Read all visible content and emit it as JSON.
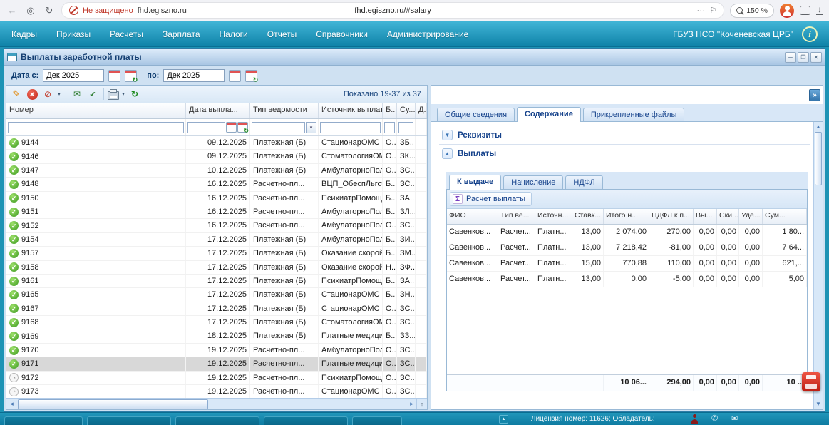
{
  "icons": {
    "back": "←",
    "site": "◎",
    "reload": "↻",
    "more": "⋯",
    "bookmark": "⚐",
    "download": "↓",
    "info": "i",
    "minimize": "─",
    "restore": "❐",
    "close": "✕",
    "edit": "✎",
    "delete": "✖",
    "sign": "⊘",
    "mail": "✉",
    "confirm": "✔",
    "dropdown": "▾",
    "refresh": "↻",
    "collapse": "»",
    "expand": "▼",
    "collapse_section": "▲",
    "sigma": "Σ",
    "scroll_left": "◂",
    "scroll_right": "▸",
    "scroll_up": "▲",
    "scroll_down": "▼",
    "resize": "↕",
    "taskbar_up": "▲",
    "phone": "✆",
    "envelope": "✉"
  },
  "browser": {
    "security_text": "Не защищено",
    "domain": "fhd.egiszno.ru",
    "url": "fhd.egiszno.ru/#salary",
    "zoom": "150 %"
  },
  "menubar": {
    "items": [
      "Кадры",
      "Приказы",
      "Расчеты",
      "Зарплата",
      "Налоги",
      "Отчеты",
      "Справочники",
      "Администрирование"
    ],
    "org": "ГБУЗ НСО \"Коченевская ЦРБ\""
  },
  "window_title": "Выплаты заработной платы",
  "filters": {
    "date_from_label": "Дата с:",
    "date_from_value": "Дек 2025",
    "date_to_label": "по:",
    "date_to_value": "Дек 2025"
  },
  "left_grid": {
    "shown_text": "Показано 19-37 из 37",
    "columns": [
      "Номер",
      "Дата выпла...",
      "Тип ведомости",
      "Источник выплат",
      "Б...",
      "Су...",
      "Д..."
    ],
    "rows": [
      {
        "num": "9144",
        "date": "09.12.2025",
        "type": "Платежная (Б)",
        "source": "СтационарОМС",
        "c5": "О...",
        "c6": "ЗБ...",
        "icon": "check"
      },
      {
        "num": "9146",
        "date": "09.12.2025",
        "type": "Платежная (Б)",
        "source": "СтоматологияОМС",
        "c5": "О...",
        "c6": "ЗК...",
        "icon": "check"
      },
      {
        "num": "9147",
        "date": "10.12.2025",
        "type": "Платежная (Б)",
        "source": "АмбулаторноПолик...",
        "c5": "О...",
        "c6": "ЗС...",
        "icon": "check"
      },
      {
        "num": "9148",
        "date": "16.12.2025",
        "type": "Расчетно-пл...",
        "source": "ВЦП_ОбеспЛьготно...",
        "c5": "Б...",
        "c6": "ЗС...",
        "icon": "check"
      },
      {
        "num": "9150",
        "date": "16.12.2025",
        "type": "Расчетно-пл...",
        "source": "ПсихиатрПомощь",
        "c5": "Б...",
        "c6": "ЗА...",
        "icon": "check"
      },
      {
        "num": "9151",
        "date": "16.12.2025",
        "type": "Расчетно-пл...",
        "source": "АмбулаторноПолик...",
        "c5": "Б...",
        "c6": "ЗЛ...",
        "icon": "check"
      },
      {
        "num": "9152",
        "date": "16.12.2025",
        "type": "Расчетно-пл...",
        "source": "АмбулаторноПолик...",
        "c5": "О...",
        "c6": "ЗС...",
        "icon": "check"
      },
      {
        "num": "9154",
        "date": "17.12.2025",
        "type": "Платежная (Б)",
        "source": "АмбулаторноПолик...",
        "c5": "Б...",
        "c6": "ЗИ...",
        "icon": "check"
      },
      {
        "num": "9157",
        "date": "17.12.2025",
        "type": "Платежная (Б)",
        "source": "Оказание скорой по...",
        "c5": "Б...",
        "c6": "ЗМ...",
        "icon": "check"
      },
      {
        "num": "9158",
        "date": "17.12.2025",
        "type": "Платежная (Б)",
        "source": "Оказание скорой по...",
        "c5": "Н...",
        "c6": "ЗФ...",
        "icon": "check"
      },
      {
        "num": "9161",
        "date": "17.12.2025",
        "type": "Платежная (Б)",
        "source": "ПсихиатрПомощь",
        "c5": "Б...",
        "c6": "ЗА...",
        "icon": "check"
      },
      {
        "num": "9165",
        "date": "17.12.2025",
        "type": "Платежная (Б)",
        "source": "СтационарОМС",
        "c5": "Б...",
        "c6": "ЗН...",
        "icon": "check"
      },
      {
        "num": "9167",
        "date": "17.12.2025",
        "type": "Платежная (Б)",
        "source": "СтационарОМС",
        "c5": "О...",
        "c6": "ЗС...",
        "icon": "check"
      },
      {
        "num": "9168",
        "date": "17.12.2025",
        "type": "Платежная (Б)",
        "source": "СтоматологияОМС",
        "c5": "О...",
        "c6": "ЗС...",
        "icon": "check"
      },
      {
        "num": "9169",
        "date": "18.12.2025",
        "type": "Платежная (Б)",
        "source": "Платные медицинск...",
        "c5": "Б...",
        "c6": "ЗЗ...",
        "icon": "check"
      },
      {
        "num": "9170",
        "date": "19.12.2025",
        "type": "Расчетно-пл...",
        "source": "АмбулаторноПолик...",
        "c5": "О...",
        "c6": "ЗС...",
        "icon": "check"
      },
      {
        "num": "9171",
        "date": "19.12.2025",
        "type": "Расчетно-пл...",
        "source": "Платные медицинск...",
        "c5": "О...",
        "c6": "ЗС...",
        "icon": "check",
        "selected": true
      },
      {
        "num": "9172",
        "date": "19.12.2025",
        "type": "Расчетно-пл...",
        "source": "ПсихиатрПомощь",
        "c5": "О...",
        "c6": "ЗС...",
        "icon": "clock"
      },
      {
        "num": "9173",
        "date": "19.12.2025",
        "type": "Расчетно-пл...",
        "source": "СтационарОМС",
        "c5": "О...",
        "c6": "ЗС...",
        "icon": "clock"
      }
    ]
  },
  "right_panel": {
    "tabs": [
      {
        "label": "Общие сведения",
        "active": false
      },
      {
        "label": "Содержание",
        "active": true
      },
      {
        "label": "Прикрепленные файлы",
        "active": false
      }
    ],
    "section_requisites": "Реквизиты",
    "section_payments": "Выплаты",
    "subtabs": [
      {
        "label": "К выдаче",
        "active": true
      },
      {
        "label": "Начисление",
        "active": false
      },
      {
        "label": "НДФЛ",
        "active": false
      }
    ],
    "calc_button": "Расчет выплаты",
    "grid": {
      "columns": [
        "ФИО",
        "Тип ве...",
        "Источн...",
        "Ставк...",
        "Итого н...",
        "НДФЛ к п...",
        "Вы...",
        "Ски...",
        "Уде...",
        "Сум..."
      ],
      "rows": [
        {
          "fio": "Савенков...",
          "type": "Расчет...",
          "src": "Платн...",
          "rate": "13,00",
          "total": "2 074,00",
          "ndfl": "270,00",
          "vy": "0,00",
          "ski": "0,00",
          "ude": "0,00",
          "sum": "1 80..."
        },
        {
          "fio": "Савенков...",
          "type": "Расчет...",
          "src": "Платн...",
          "rate": "13,00",
          "total": "7 218,42",
          "ndfl": "-81,00",
          "vy": "0,00",
          "ski": "0,00",
          "ude": "0,00",
          "sum": "7 64..."
        },
        {
          "fio": "Савенков...",
          "type": "Расчет...",
          "src": "Платн...",
          "rate": "15,00",
          "total": "770,88",
          "ndfl": "110,00",
          "vy": "0,00",
          "ski": "0,00",
          "ude": "0,00",
          "sum": "621,..."
        },
        {
          "fio": "Савенков...",
          "type": "Расчет...",
          "src": "Платн...",
          "rate": "13,00",
          "total": "0,00",
          "ndfl": "-5,00",
          "vy": "0,00",
          "ski": "0,00",
          "ude": "0,00",
          "sum": "5,00"
        }
      ],
      "totals": {
        "total": "10 06...",
        "ndfl": "294,00",
        "vy": "0,00",
        "ski": "0,00",
        "ude": "0,00",
        "sum": "10 ..."
      }
    }
  },
  "statusbar": {
    "license": "Лицензия номер: 11626; Обладатель:"
  }
}
